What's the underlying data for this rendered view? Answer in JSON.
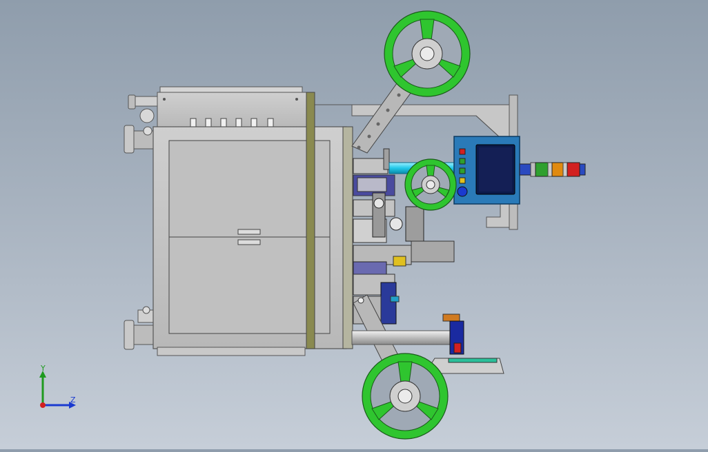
{
  "viewport": {
    "background_top": "#8f9dac",
    "background_bottom": "#c6ced8"
  },
  "colors": {
    "reel_green": "#2fc52f",
    "frame_gray": "#c4c4c4",
    "panel_blue": "#2a7ab8",
    "screen_navy": "#0b1a4a",
    "cyan_shaft": "#22c8e8"
  },
  "reels": [
    {
      "name": "top-reel"
    },
    {
      "name": "middle-reel"
    },
    {
      "name": "bottom-reel"
    }
  ],
  "control_panel": {
    "buttons": [
      "red",
      "green",
      "green",
      "yellow"
    ],
    "button_colors": [
      "#d22020",
      "#2fa02f",
      "#2fa02f",
      "#e0c020"
    ],
    "knob_color": "#1a3ad0"
  },
  "signal_tower": {
    "segments": [
      "blue",
      "green",
      "orange",
      "red",
      "blue"
    ],
    "segment_colors": [
      "#2a4ac0",
      "#2fa02f",
      "#e08a10",
      "#d22020",
      "#2a4ac0"
    ]
  },
  "axis_triad": {
    "y_label": "Y",
    "z_label": "Z",
    "y_color": "#1f9a1f",
    "z_color": "#1a3ad0",
    "x_color": "#d22020"
  }
}
